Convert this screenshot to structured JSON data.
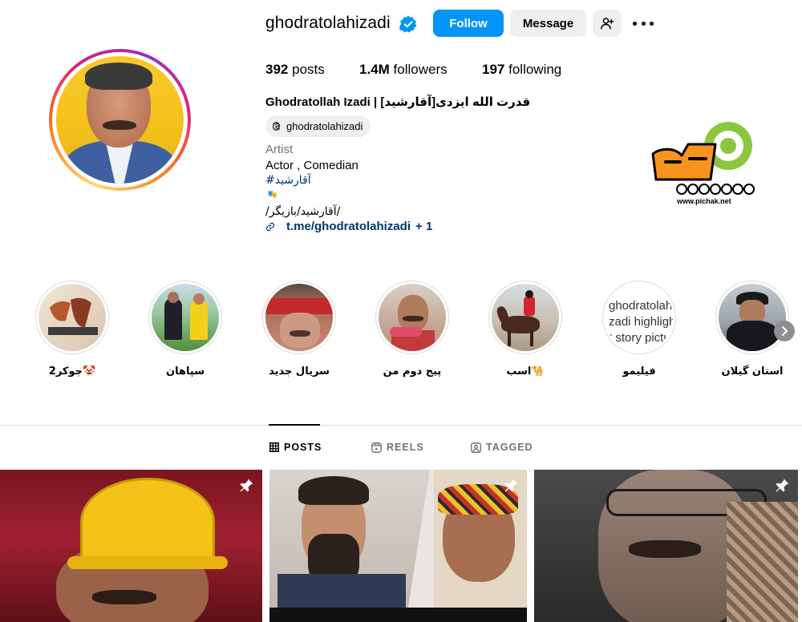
{
  "profile": {
    "username": "ghodratolahizadi",
    "full_name": "Ghodratollah Izadi | قدرت الله ایزدی[آقارشید]",
    "posts_count": "392",
    "posts_label": "posts",
    "followers_count": "1.4M",
    "followers_label": "followers",
    "following_count": "197",
    "following_label": "following",
    "threads_handle": "ghodratolahizadi",
    "category": "Artist",
    "bio_line1": "Actor , Comedian",
    "bio_hashtag": "#آقارشید",
    "bio_line3": "/آقارشید/بازیگر/",
    "link_text": "t.me/ghodratolahizadi",
    "link_more": "+ 1"
  },
  "buttons": {
    "follow": "Follow",
    "message": "Message"
  },
  "watermark": {
    "text": "www.pichak.net"
  },
  "highlights": [
    {
      "label": "جوکر2🤡"
    },
    {
      "label": "سپاهان"
    },
    {
      "label": "سریال جدید"
    },
    {
      "label": "پیج دوم من"
    },
    {
      "label": "اسب🐪"
    },
    {
      "label": "فیلیمو"
    },
    {
      "label": "استان گیلان"
    }
  ],
  "highlight_alt_text": "ghodratolahizadi highlight story picture",
  "tabs": [
    {
      "label": "POSTS",
      "icon": "grid-icon",
      "active": true
    },
    {
      "label": "REELS",
      "icon": "reels-icon",
      "active": false
    },
    {
      "label": "TAGGED",
      "icon": "tagged-icon",
      "active": false
    }
  ],
  "colors": {
    "follow_blue": "#0095f6",
    "link_blue": "#00376b",
    "button_gray": "#efefef",
    "muted_text": "#737373"
  }
}
